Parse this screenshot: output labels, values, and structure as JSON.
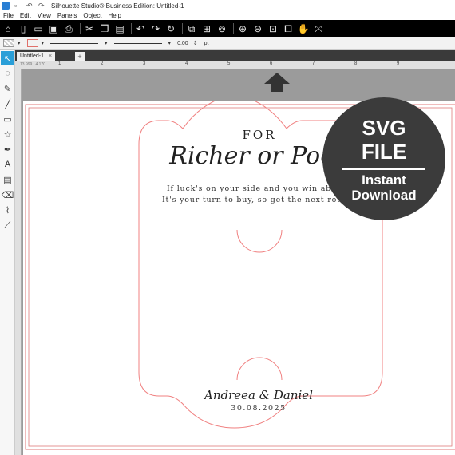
{
  "window": {
    "title": "Silhouette Studio® Business Edition: Untitled-1"
  },
  "menu": [
    "File",
    "Edit",
    "View",
    "Panels",
    "Object",
    "Help"
  ],
  "toolbar": [
    "home-icon",
    "new-icon",
    "open-icon",
    "save-icon",
    "print-icon",
    "cut-icon",
    "copy-icon",
    "paste-icon",
    "undo-icon",
    "redo-icon",
    "redraw-icon",
    "group-icon",
    "ungroup-icon",
    "release-icon",
    "zoom-in-icon",
    "zoom-out-icon",
    "zoom-fit-icon",
    "select-all-icon",
    "pan-icon",
    "fit-page-icon"
  ],
  "properties": {
    "stroke_width": "0.00",
    "unit": "pt"
  },
  "tab": {
    "label": "Untitled-1",
    "close": "×",
    "add": "+"
  },
  "ruler": {
    "numbers": [
      "1",
      "2",
      "3",
      "4",
      "5",
      "6",
      "7",
      "8",
      "9"
    ],
    "coord": "13.999 , 4.170"
  },
  "design": {
    "title_top": "FOR",
    "title_script": "Richer or Poorer",
    "line1": "If luck's on your side and you win above,",
    "line2": "It's your turn to buy, so get the next round!",
    "names": "Andreea & Daniel",
    "date": "30.08.2025"
  },
  "badge": {
    "line1": "SVG",
    "line2": "FILE",
    "line3": "Instant",
    "line4": "Download"
  },
  "colors": {
    "cut_line": "#f08080",
    "toolbar_bg": "#000000",
    "active_tool": "#2a9fd8",
    "workspace": "#9b9b9b",
    "badge_bg": "#3b3b3b"
  }
}
